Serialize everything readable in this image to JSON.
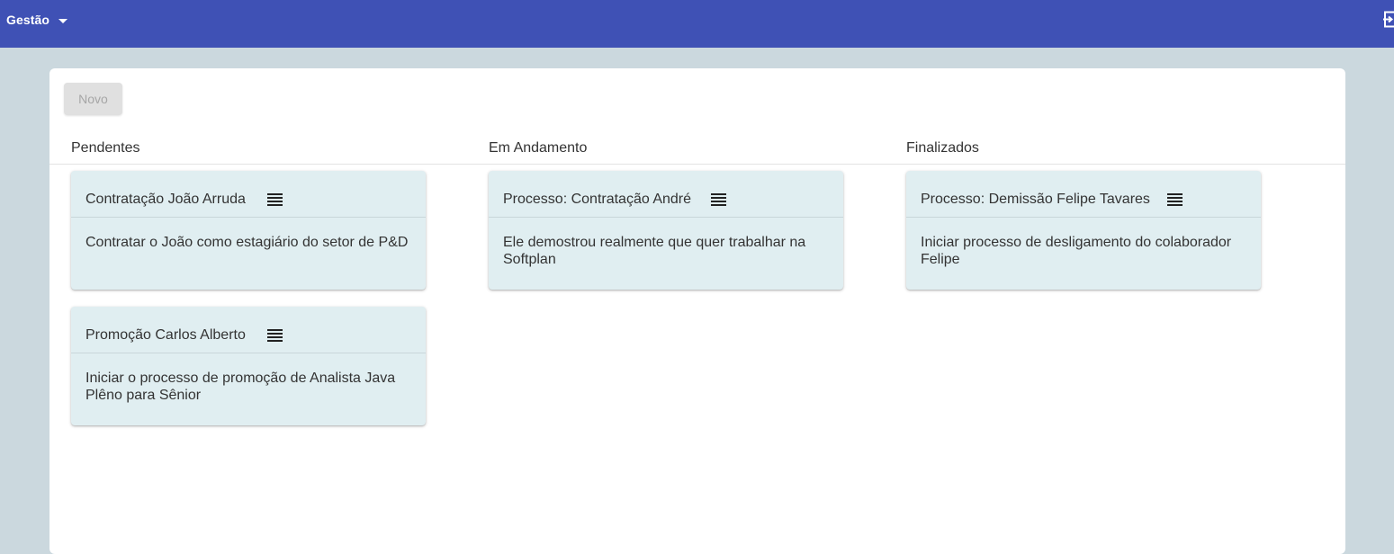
{
  "topbar": {
    "menu_label": "Gestão",
    "icons": {
      "menu_caret": "arrow-drop-down-icon",
      "logout": "exit-to-app-icon"
    },
    "color": "#3f51b5"
  },
  "toolbar": {
    "new_label": "Novo"
  },
  "columns": [
    {
      "title": "Pendentes",
      "cards": [
        {
          "title": "Contratação João Arruda",
          "description": "Contratar o João como estagiário do setor de P&D"
        },
        {
          "title": "Promoção Carlos Alberto",
          "description": "Iniciar o processo de promoção de Analista Java Plêno para Sênior"
        }
      ]
    },
    {
      "title": "Em Andamento",
      "cards": [
        {
          "title": "Processo: Contratação André",
          "description": "Ele demostrou realmente que quer trabalhar na Softplan"
        }
      ]
    },
    {
      "title": "Finalizados",
      "cards": [
        {
          "title": "Processo: Demissão Felipe Tavares",
          "description": "Iniciar processo de desligamento do colaborador Felipe"
        }
      ]
    }
  ],
  "card_menu_icon": "list-lines-icon",
  "colors": {
    "page_bg": "#cbd8de",
    "card_bg": "#e0eef1",
    "button_bg": "#e0e0e0"
  }
}
